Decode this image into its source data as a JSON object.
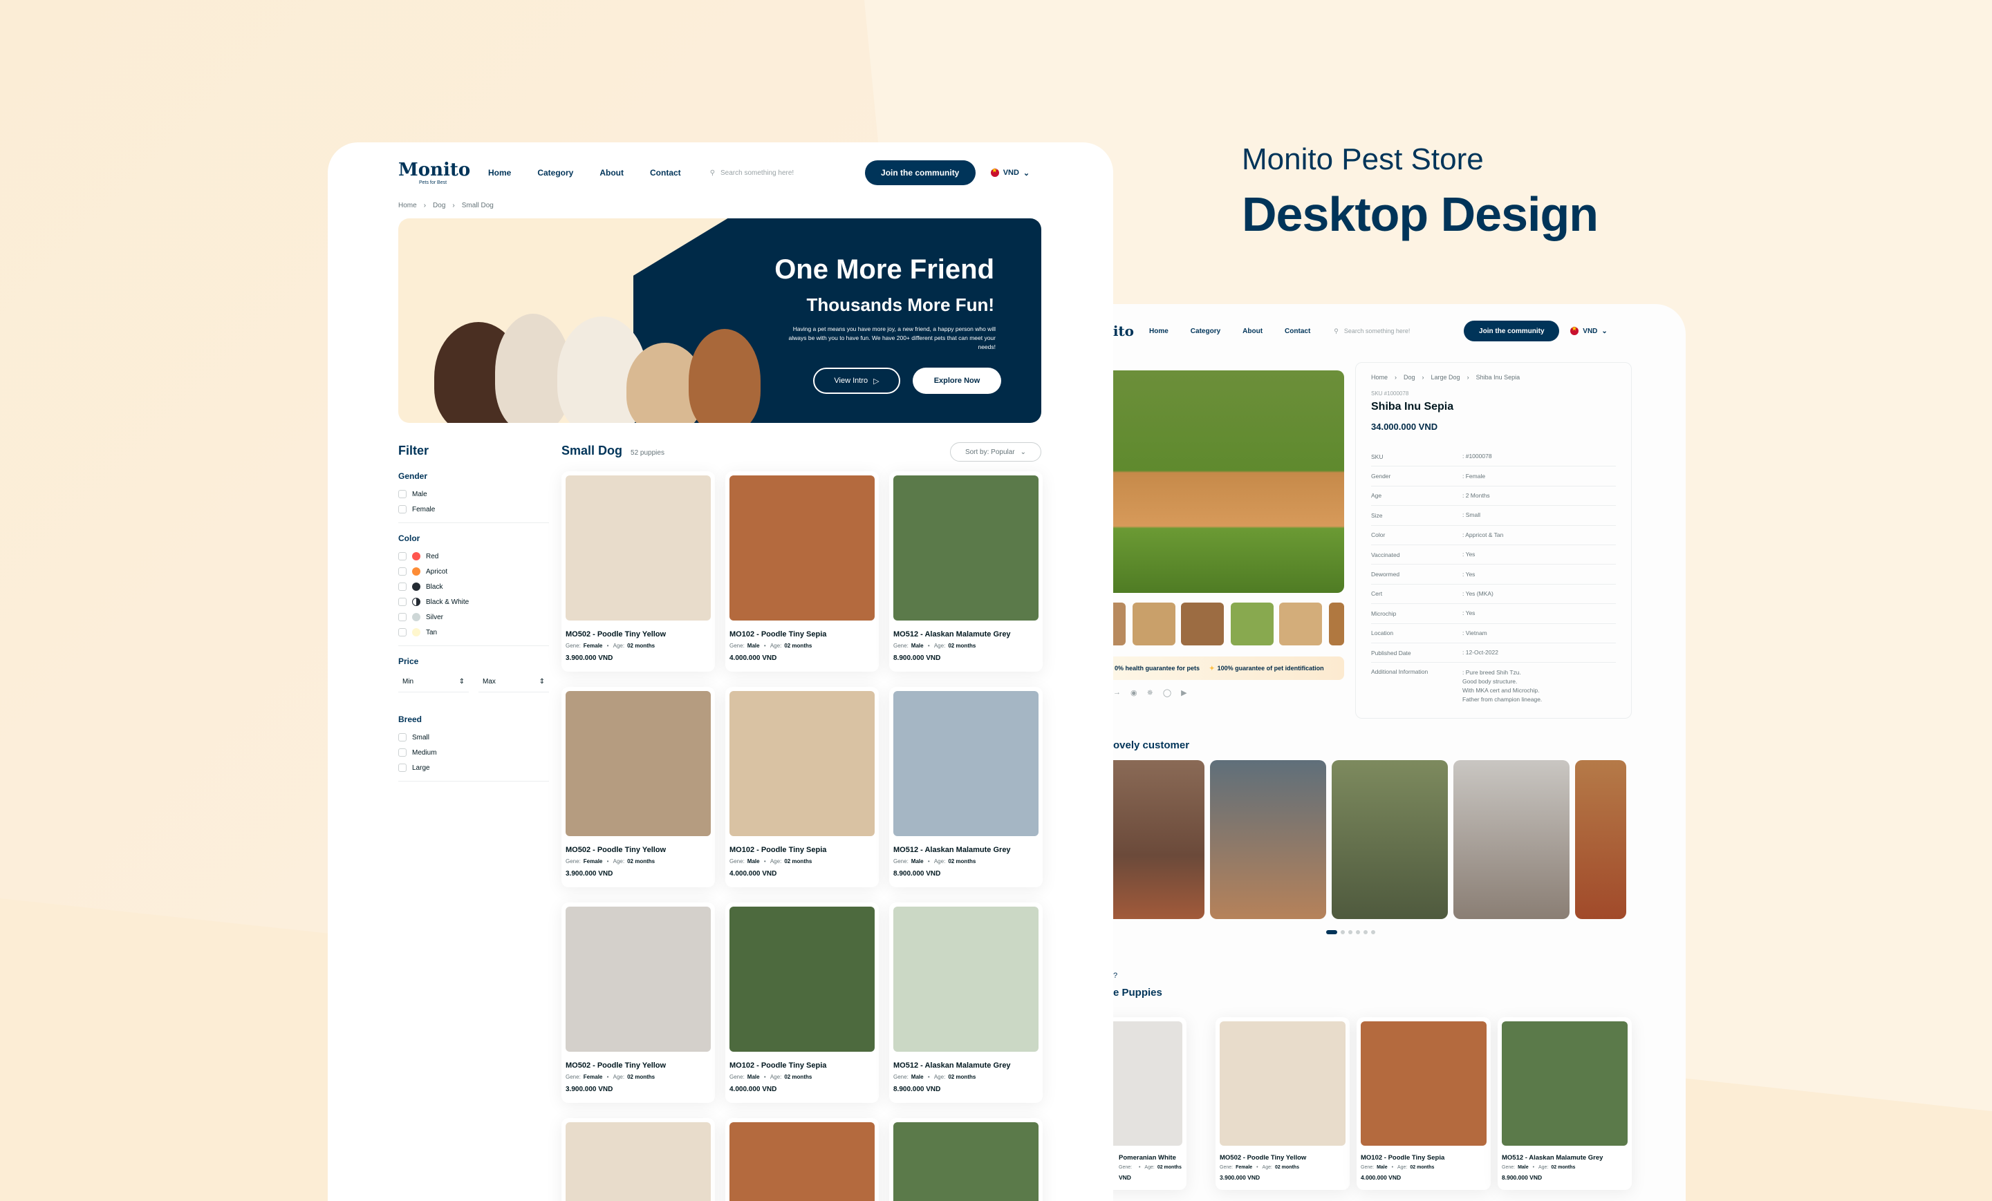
{
  "showcase": {
    "title": "Monito Pest Store",
    "subtitle": "Desktop Design"
  },
  "nav": {
    "logo": "Monito",
    "logo_tagline": "Pets for Best",
    "links": [
      "Home",
      "Category",
      "About",
      "Contact"
    ],
    "search_placeholder": "Search something here!",
    "join_label": "Join the community",
    "currency": "VND"
  },
  "listing": {
    "breadcrumb": [
      "Home",
      "Dog",
      "Small Dog"
    ],
    "banner": {
      "title": "One More Friend",
      "subtitle": "Thousands More Fun!",
      "text": "Having a pet means you have more joy, a new friend, a happy person who will always be with you to have fun. We have 200+ different pets that can meet your needs!",
      "btn_intro": "View Intro",
      "btn_explore": "Explore Now"
    },
    "filter": {
      "title": "Filter",
      "gender": {
        "title": "Gender",
        "options": [
          "Male",
          "Female"
        ]
      },
      "color": {
        "title": "Color",
        "options": [
          {
            "label": "Red",
            "color": "#ff564f"
          },
          {
            "label": "Apricot",
            "color": "#fd8c36"
          },
          {
            "label": "Black",
            "color": "#242b33"
          },
          {
            "label": "Black & White",
            "color": "#242b33"
          },
          {
            "label": "Silver",
            "color": "#ced7d7"
          },
          {
            "label": "Tan",
            "color": "#fff7ce"
          }
        ]
      },
      "price": {
        "title": "Price",
        "min": "Min",
        "max": "Max"
      },
      "breed": {
        "title": "Breed",
        "options": [
          "Small",
          "Medium",
          "Large"
        ]
      }
    },
    "grid": {
      "title": "Small Dog",
      "count": "52 puppies",
      "sort": "Sort by: Popular",
      "gene_label": "Gene:",
      "age_label": "Age:",
      "cards": [
        {
          "name": "MO502 - Poodle Tiny Yellow",
          "gene": "Female",
          "age": "02 months",
          "price": "3.900.000 VND",
          "color": "#e8dccb"
        },
        {
          "name": "MO102 - Poodle Tiny Sepia",
          "gene": "Male",
          "age": "02 months",
          "price": "4.000.000 VND",
          "color": "#b46a3e"
        },
        {
          "name": "MO512 - Alaskan Malamute Grey",
          "gene": "Male",
          "age": "02 months",
          "price": "8.900.000 VND",
          "color": "#5b7a4a"
        },
        {
          "name": "MO502 - Poodle Tiny Yellow",
          "gene": "Female",
          "age": "02 months",
          "price": "3.900.000 VND",
          "color": "#b59c80"
        },
        {
          "name": "MO102 - Poodle Tiny Sepia",
          "gene": "Male",
          "age": "02 months",
          "price": "4.000.000 VND",
          "color": "#d9c2a3"
        },
        {
          "name": "MO512 - Alaskan Malamute Grey",
          "gene": "Male",
          "age": "02 months",
          "price": "8.900.000 VND",
          "color": "#a5b6c4"
        },
        {
          "name": "MO502 - Poodle Tiny Yellow",
          "gene": "Female",
          "age": "02 months",
          "price": "3.900.000 VND",
          "color": "#d4d0cb"
        },
        {
          "name": "MO102 - Poodle Tiny Sepia",
          "gene": "Male",
          "age": "02 months",
          "price": "4.000.000 VND",
          "color": "#4d6a3e"
        },
        {
          "name": "MO512 - Alaskan Malamute Grey",
          "gene": "Male",
          "age": "02 months",
          "price": "8.900.000 VND",
          "color": "#cbd8c5"
        }
      ]
    }
  },
  "detail": {
    "breadcrumb": [
      "Home",
      "Dog",
      "Large Dog",
      "Shiba Inu Sepia"
    ],
    "sku_line": "SKU #1000078",
    "name": "Shiba Inu Sepia",
    "price": "34.000.000 VND",
    "specs": [
      {
        "k": "SKU",
        "v": ": #1000078"
      },
      {
        "k": "Gender",
        "v": ": Female"
      },
      {
        "k": "Age",
        "v": ": 2 Months"
      },
      {
        "k": "Size",
        "v": ": Small"
      },
      {
        "k": "Color",
        "v": ": Appricot & Tan"
      },
      {
        "k": "Vaccinated",
        "v": ": Yes"
      },
      {
        "k": "Dewormed",
        "v": ": Yes"
      },
      {
        "k": "Cert",
        "v": ": Yes (MKA)"
      },
      {
        "k": "Microchip",
        "v": ": Yes"
      },
      {
        "k": "Location",
        "v": ": Vietnam"
      },
      {
        "k": "Published Date",
        "v": ": 12-Oct-2022"
      },
      {
        "k": "Additional Information",
        "v": ": Pure breed Shih Tzu.\nGood body structure.\nWith MKA cert and Microchip.\nFather from champion lineage."
      }
    ],
    "guarantee_1": "0% health guarantee for pets",
    "guarantee_2": "100% guarantee of pet identification",
    "customer_title": "ovely customer",
    "puppies_q": "?",
    "puppies_title": "e Puppies",
    "related": [
      {
        "name": "Pomeranian White",
        "gene": "",
        "age": "02 months",
        "price": "VND",
        "color": "#e4e2df"
      },
      {
        "name": "MO502 - Poodle Tiny Yellow",
        "gene": "Female",
        "age": "02 months",
        "price": "3.900.000 VND",
        "color": "#e8dccb"
      },
      {
        "name": "MO102 - Poodle Tiny Sepia",
        "gene": "Male",
        "age": "02 months",
        "price": "4.000.000 VND",
        "color": "#b46a3e"
      },
      {
        "name": "MO512 - Alaskan Malamute Grey",
        "gene": "Male",
        "age": "02 months",
        "price": "8.900.000 VND",
        "color": "#5b7a4a"
      }
    ]
  }
}
